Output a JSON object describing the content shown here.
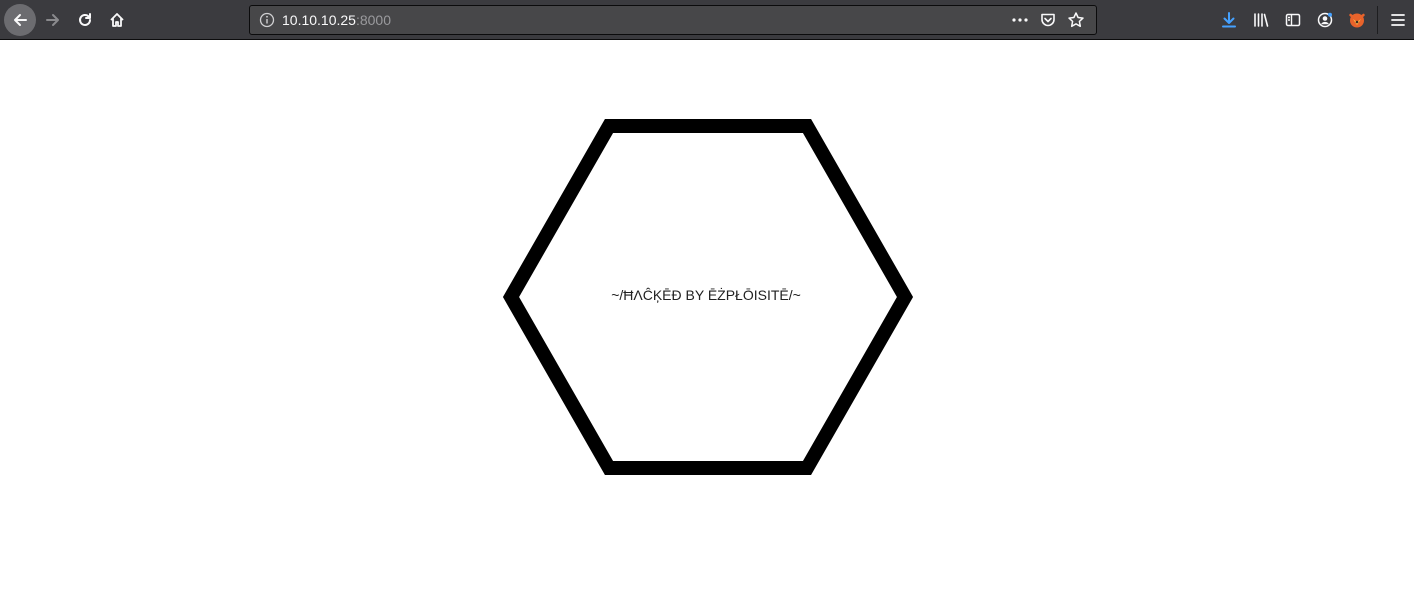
{
  "browser": {
    "url_host": "10.10.10.25",
    "url_port": ":8000",
    "icons": {
      "back": "back-arrow-icon",
      "forward": "forward-arrow-icon",
      "reload": "reload-icon",
      "home": "home-icon",
      "info": "info-icon",
      "page_actions": "more-horizontal-icon",
      "pocket": "pocket-icon",
      "bookmark": "star-icon",
      "downloads": "download-icon",
      "library": "library-icon",
      "sidebar": "sidebar-icon",
      "account": "account-icon",
      "extension": "fox-extension-icon",
      "menu": "hamburger-menu-icon"
    },
    "colors": {
      "toolbar": "#3b3b3f",
      "urlbar": "#474749",
      "download_accent": "#45a1ff"
    }
  },
  "page": {
    "message": "~/ĦΛĈĶĒĐ BY ĒŻPŁŌISITĒ/~",
    "colors": {
      "background": "#ffffff",
      "hexagon_stroke": "#000000"
    }
  }
}
